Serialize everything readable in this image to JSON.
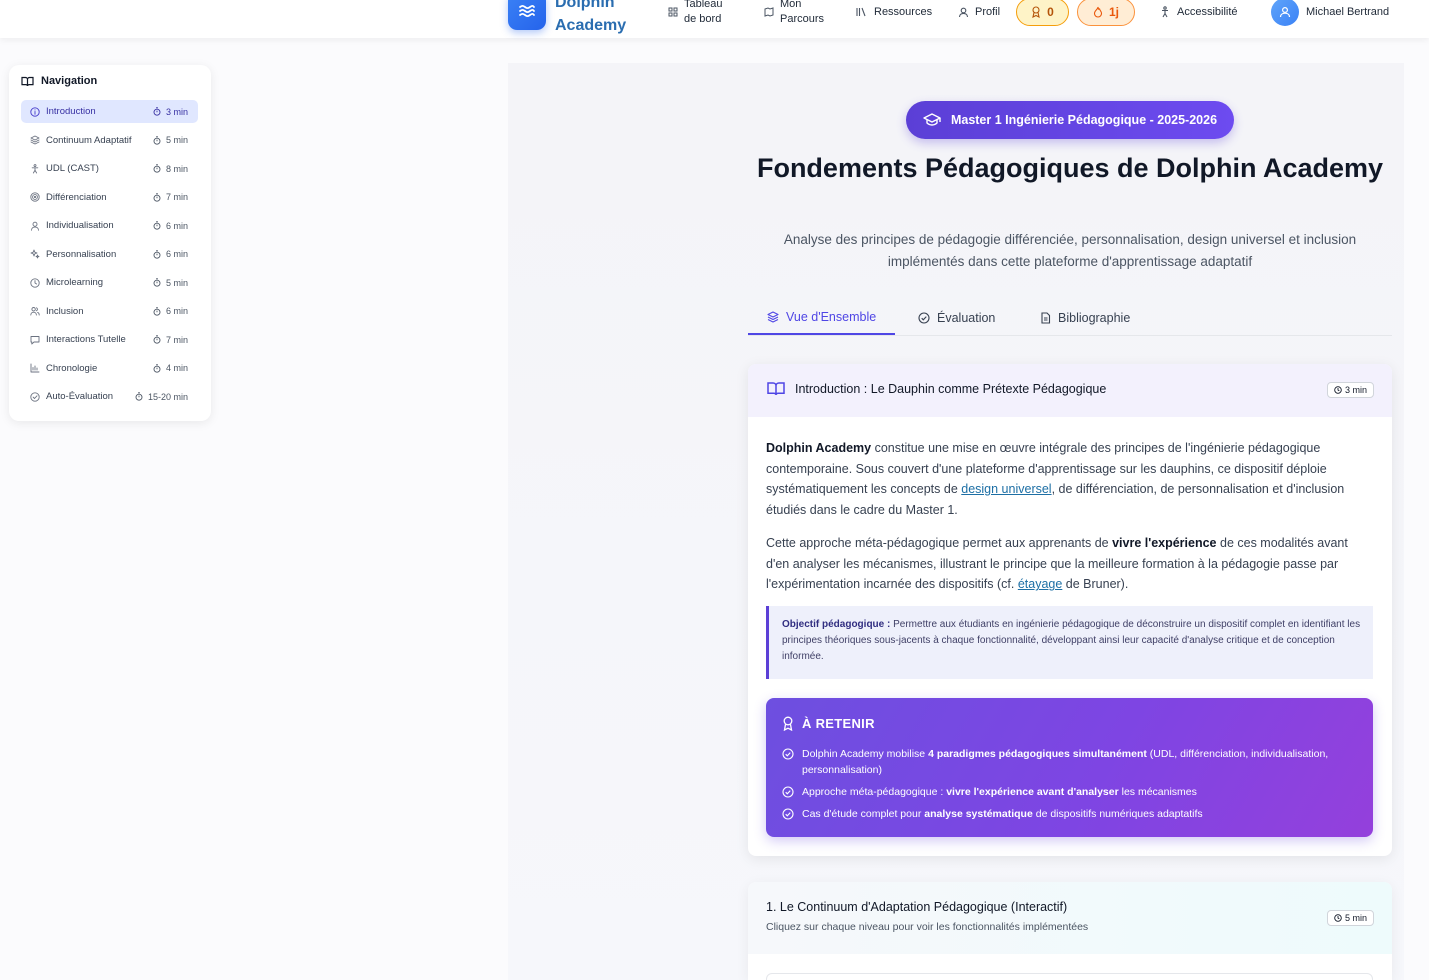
{
  "header": {
    "app_name": "Dolphin Academy",
    "nav": [
      {
        "label": "Tableau de bord",
        "icon": "dashboard-icon"
      },
      {
        "label": "Mon Parcours",
        "icon": "map-icon"
      },
      {
        "label": "Ressources",
        "icon": "library-icon"
      },
      {
        "label": "Profil",
        "icon": "user-icon"
      }
    ],
    "badges_count": "0",
    "streak": "1j",
    "accessibility": "Accessibilité",
    "user_name": "Michael Bertrand"
  },
  "sidebar": {
    "title": "Navigation",
    "items": [
      {
        "label": "Introduction",
        "duration": "3 min",
        "icon": "info-icon",
        "active": true
      },
      {
        "label": "Continuum Adaptatif",
        "duration": "5 min",
        "icon": "layers-icon"
      },
      {
        "label": "UDL (CAST)",
        "duration": "8 min",
        "icon": "accessibility-icon"
      },
      {
        "label": "Différenciation",
        "duration": "7 min",
        "icon": "target-icon"
      },
      {
        "label": "Individualisation",
        "duration": "6 min",
        "icon": "user-icon"
      },
      {
        "label": "Personnalisation",
        "duration": "6 min",
        "icon": "sparkles-icon"
      },
      {
        "label": "Microlearning",
        "duration": "5 min",
        "icon": "clock-icon"
      },
      {
        "label": "Inclusion",
        "duration": "6 min",
        "icon": "users-icon"
      },
      {
        "label": "Interactions Tutelle",
        "duration": "7 min",
        "icon": "message-icon"
      },
      {
        "label": "Chronologie",
        "duration": "4 min",
        "icon": "chart-icon"
      },
      {
        "label": "Auto-Évaluation",
        "duration": "15-20 min",
        "icon": "check-circle-icon"
      }
    ]
  },
  "main": {
    "program_badge": "Master 1 Ingénierie Pédagogique - 2025-2026",
    "title": "Fondements Pédagogiques de Dolphin Academy",
    "subtitle": "Analyse des principes de pédagogie différenciée, personnalisation, design universel et inclusion implémentés dans cette plateforme d'apprentissage adaptatif",
    "tabs": [
      {
        "label": "Vue d'Ensemble",
        "active": true
      },
      {
        "label": "Évaluation"
      },
      {
        "label": "Bibliographie"
      }
    ],
    "intro_card": {
      "title": "Introduction : Le Dauphin comme Prétexte Pédagogique",
      "duration": "3 min",
      "p1": {
        "lead": "Dolphin Academy",
        "t1": " constitue une mise en œuvre intégrale des principes de l'ingénierie pédagogique contemporaine. Sous couvert d'une plateforme d'apprentissage sur les dauphins, ce dispositif déploie systématiquement les concepts de ",
        "link": "design universel",
        "t2": ", de différenciation, de personnalisation et d'inclusion étudiés dans le cadre du Master 1."
      },
      "p2": {
        "t1": "Cette approche méta-pédagogique permet aux apprenants de ",
        "bold": "vivre l'expérience",
        "t2": " de ces modalités avant d'en analyser les mécanismes, illustrant le principe que la meilleure formation à la pédagogie passe par l'expérimentation incarnée des dispositifs (cf. ",
        "link": "étayage",
        "t3": " de Bruner)."
      },
      "objective": {
        "label": "Objectif pédagogique :",
        "text": " Permettre aux étudiants en ingénierie pédagogique de déconstruire un dispositif complet en identifiant les principes théoriques sous-jacents à chaque fonctionnalité, développant ainsi leur capacité d'analyse critique et de conception informée."
      },
      "retenir": {
        "title": "À RETENIR",
        "items": [
          {
            "pre": "Dolphin Academy mobilise ",
            "bold": "4 paradigmes pédagogiques simultanément",
            "post": " (UDL, différenciation, individualisation, personnalisation)"
          },
          {
            "pre": "Approche méta-pédagogique : ",
            "bold": "vivre l'expérience avant d'analyser",
            "post": " les mécanismes"
          },
          {
            "pre": "Cas d'étude complet pour ",
            "bold": "analyse systématique",
            "post": " de dispositifs numériques adaptatifs"
          }
        ]
      }
    },
    "continuum_card": {
      "title": "1. Le Continuum d'Adaptation Pédagogique (Interactif)",
      "subtitle": "Cliquez sur chaque niveau pour voir les fonctionnalités implémentées",
      "duration": "5 min"
    }
  },
  "colors": {
    "accent": "#5b3fd6",
    "tab_active": "#4f46e5",
    "logo": "#2563eb",
    "gold": "#f59e0b",
    "fire": "#ea580c"
  }
}
